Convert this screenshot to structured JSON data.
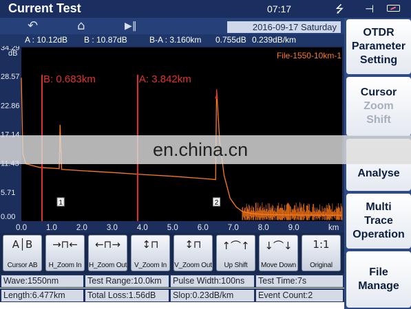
{
  "header": {
    "title": "Current Test",
    "time": "07:17",
    "icons": [
      "usb-icon",
      "plug-icon",
      "battery-icon"
    ]
  },
  "toolbar": {
    "icons": [
      "back-arrow-icon",
      "home-icon",
      "play-pause-icon"
    ],
    "date": "2016-09-17 Saturday"
  },
  "info": {
    "a": "A : 10.12dB",
    "b": "B : 10.87dB",
    "ba": "B-A : 3.160km",
    "loss": "0.755dB",
    "slope": "0.239dB/km"
  },
  "chart_data": {
    "type": "line",
    "file_label": "File-1550-10km-1",
    "xlabel": "km",
    "ylabel": "dB",
    "xlim": [
      0.0,
      10.6
    ],
    "ylim": [
      0.0,
      34.29
    ],
    "x_ticks": [
      "0.0",
      "1.0",
      "2.0",
      "3.0",
      "4.0",
      "5.0",
      "6.0",
      "7.0",
      "8.0",
      "9.0"
    ],
    "y_ticks": [
      "34.29",
      "28.57",
      "22.86",
      "17.14",
      "11.43",
      "5.71",
      "0.00"
    ],
    "cursors": [
      {
        "name": "B",
        "label": "B: 0.683km",
        "x": 0.683
      },
      {
        "name": "A",
        "label": "A: 3.842km",
        "x": 3.842
      }
    ],
    "events": [
      {
        "label": "1",
        "x": 1.3
      },
      {
        "label": "2",
        "x": 6.45
      }
    ],
    "series": [
      {
        "color": "#ff7a1a",
        "points": [
          [
            0.0,
            28.3
          ],
          [
            0.05,
            13.2
          ],
          [
            0.15,
            11.3
          ],
          [
            0.6,
            10.6
          ],
          [
            1.25,
            10.35
          ],
          [
            1.28,
            19.0
          ],
          [
            1.33,
            10.2
          ],
          [
            2.0,
            9.95
          ],
          [
            3.0,
            9.6
          ],
          [
            4.0,
            9.2
          ],
          [
            5.0,
            8.85
          ],
          [
            6.0,
            8.4
          ],
          [
            6.42,
            8.2
          ],
          [
            6.45,
            26.0
          ],
          [
            6.55,
            16.0
          ],
          [
            6.7,
            9.0
          ],
          [
            6.9,
            4.5
          ],
          [
            7.1,
            2.8
          ],
          [
            7.3,
            1.9
          ],
          [
            7.6,
            1.5
          ],
          [
            8.0,
            1.3
          ],
          [
            9.0,
            1.2
          ],
          [
            10.6,
            1.15
          ]
        ]
      }
    ]
  },
  "tools": [
    {
      "label": "Cursor AB",
      "glyph": "A│B"
    },
    {
      "label": "H_Zoom In",
      "glyph": "→⊓←"
    },
    {
      "label": "H_Zoom Out",
      "glyph": "←⊓→"
    },
    {
      "label": "V_Zoom In",
      "glyph": "↕⊓"
    },
    {
      "label": "V_Zoom Out",
      "glyph": "↕⊓"
    },
    {
      "label": "Up Shift",
      "glyph": "↑⌒↑"
    },
    {
      "label": "Move Down",
      "glyph": "↓⌒↓"
    },
    {
      "label": "Original",
      "glyph": "1:1"
    }
  ],
  "status": {
    "wave": "Wave:1550nm",
    "range": "Test Range:10.0km",
    "pulse": "Pulse Width:100ns",
    "time": "Test Time:7s",
    "length": "Length:6.477km",
    "total_loss": "Total Loss:1.56dB",
    "slope": "Slop:0.23dB/km",
    "events": "Event Count:2"
  },
  "side": {
    "otdr": [
      "OTDR",
      "Parameter",
      "Setting"
    ],
    "cursor": [
      "Cursor",
      "Zoom",
      "Shift"
    ],
    "analyse": "Analyse",
    "multi": [
      "Multi",
      "Trace",
      "Operation"
    ],
    "file": [
      "File",
      "Manage"
    ]
  },
  "watermark": "en.china.cn",
  "colors": {
    "plot_bg": "#000000",
    "trace": "#ff7a1a",
    "cursor": "#e03232",
    "header": "#1a2f5f",
    "side": "#2f4b86"
  }
}
